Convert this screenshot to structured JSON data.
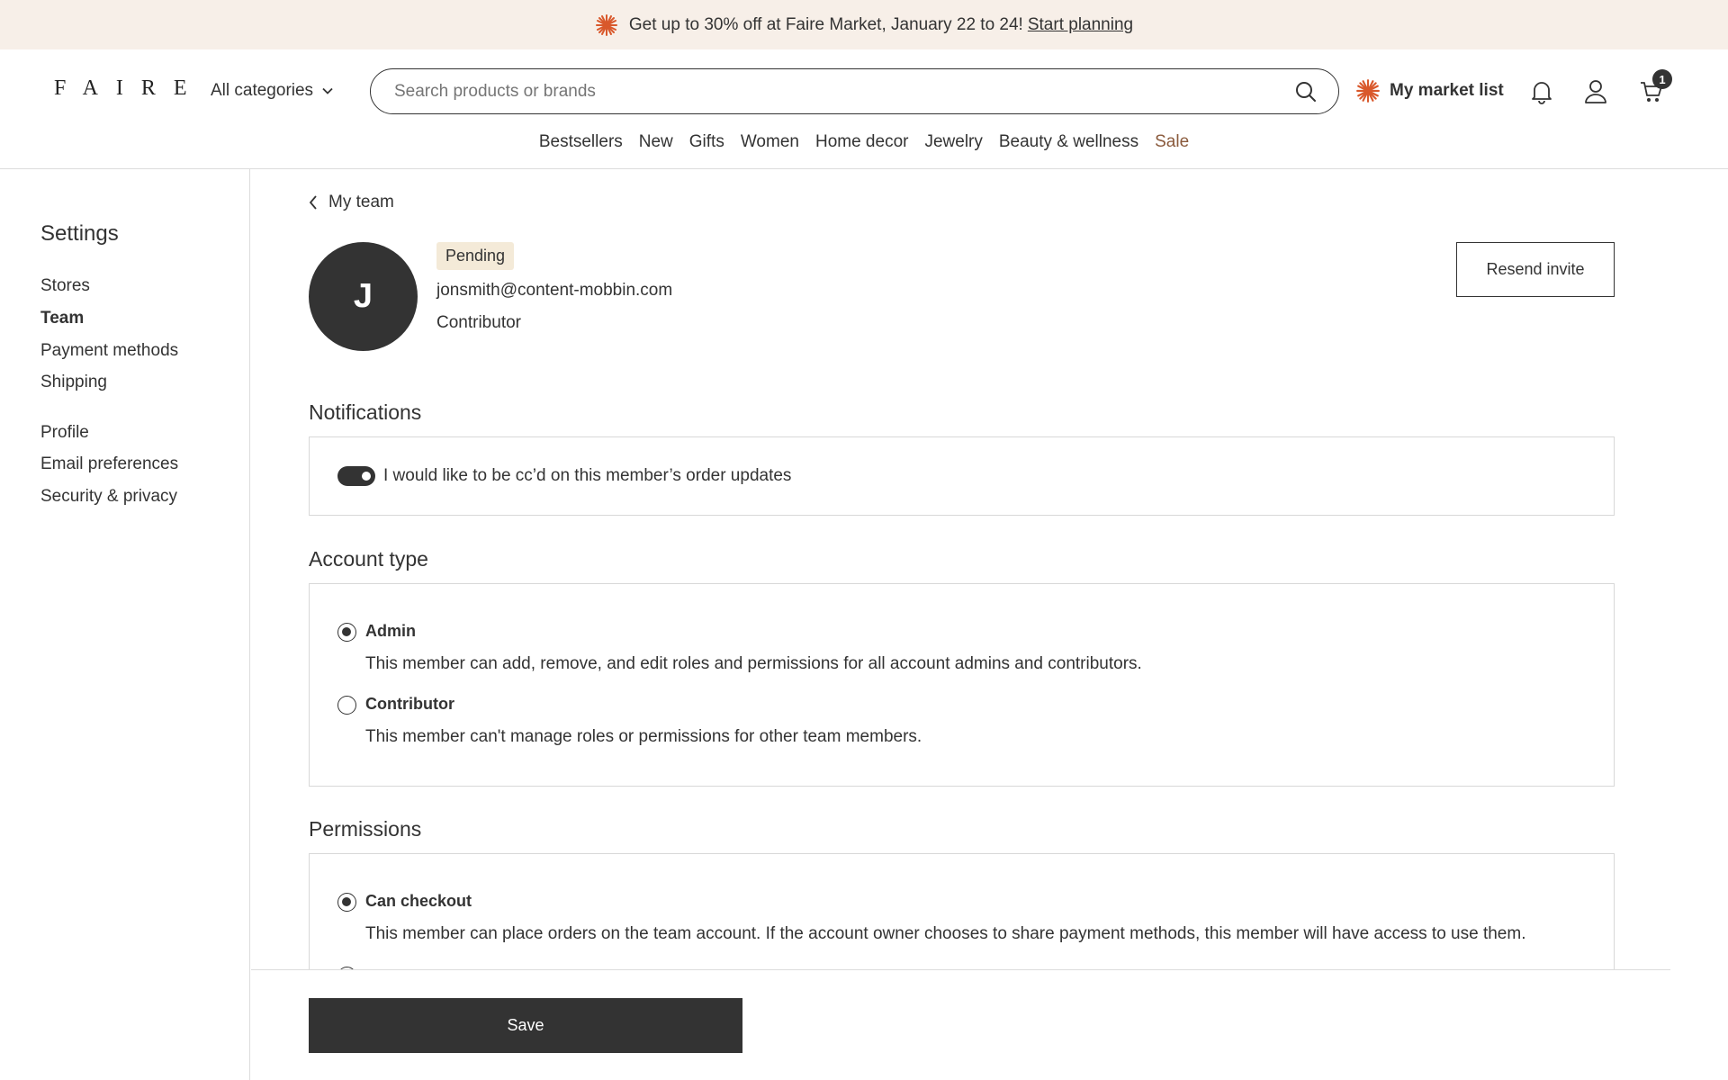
{
  "promo": {
    "text": "Get up to 30% off at Faire Market, January 22 to 24!",
    "link": "Start planning",
    "accent_color": "#d9582b",
    "icon": "sparkle-icon"
  },
  "header": {
    "logo": "FAIRE",
    "all_categories": "All categories",
    "search_placeholder": "Search products or brands",
    "market_list": "My market list",
    "cart_count": "1",
    "categories": [
      "Bestsellers",
      "New",
      "Gifts",
      "Women",
      "Home decor",
      "Jewelry",
      "Beauty & wellness",
      "Sale"
    ]
  },
  "sidebar": {
    "title": "Settings",
    "group1": [
      "Stores",
      "Team",
      "Payment methods",
      "Shipping"
    ],
    "group2": [
      "Profile",
      "Email preferences",
      "Security & privacy"
    ],
    "active": "Team"
  },
  "member": {
    "back_label": "My team",
    "initial": "J",
    "status": "Pending",
    "email": "jonsmith@content-mobbin.com",
    "role": "Contributor",
    "resend_label": "Resend invite"
  },
  "notifications": {
    "title": "Notifications",
    "toggle_label": "I would like to be cc’d on this member’s order updates",
    "toggle_on": true
  },
  "account_type": {
    "title": "Account type",
    "options": [
      {
        "label": "Admin",
        "desc": "This member can add, remove, and edit roles and permissions for all account admins and contributors.",
        "checked": true
      },
      {
        "label": "Contributor",
        "desc": "This member can't manage roles or permissions for other team members.",
        "checked": false
      }
    ]
  },
  "permissions": {
    "title": "Permissions",
    "options": [
      {
        "label": "Can checkout",
        "desc": "This member can place orders on the team account. If the account owner chooses to share payment methods, this member will have access to use them.",
        "checked": true
      }
    ]
  },
  "footer": {
    "save_label": "Save"
  }
}
